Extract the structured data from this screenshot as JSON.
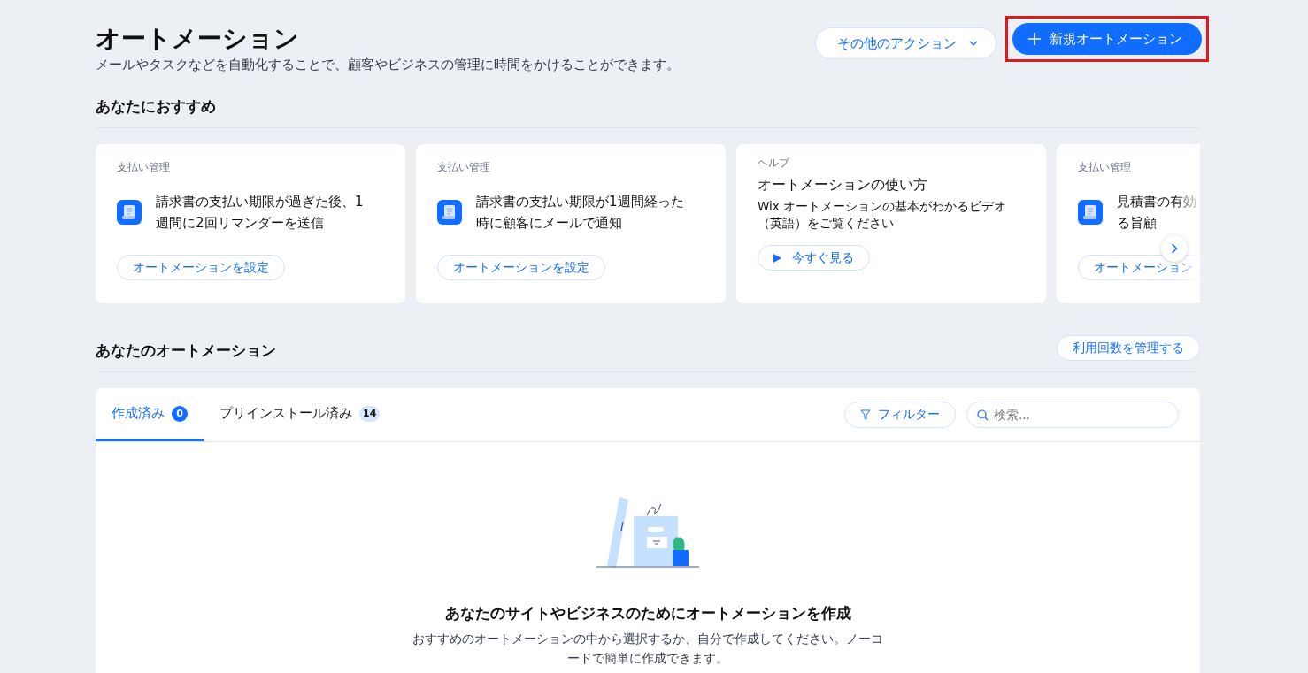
{
  "header": {
    "title": "オートメーション",
    "subtitle": "メールやタスクなどを自動化することで、顧客やビジネスの管理に時間をかけることができます。",
    "actions": [
      {
        "kind": "menu",
        "label": "その他のアクション",
        "highlighted": false
      },
      {
        "kind": "primary",
        "label": "新規オートメーション",
        "highlighted": true
      }
    ]
  },
  "recommended": {
    "heading": "あなたにおすすめ",
    "cards": [
      {
        "kind": "template",
        "category": "支払い管理",
        "title_lines": [
          "請求書の支払い期限が過ぎた後、1",
          "週間に2回リマンダーを送信"
        ],
        "button": "オートメーションを設定"
      },
      {
        "kind": "template",
        "category": "支払い管理",
        "title_lines": [
          "請求書の支払い期限が1週間経った",
          "時に顧客にメールで通知"
        ],
        "button": "オートメーションを設定"
      },
      {
        "kind": "help",
        "category": "ヘルプ",
        "title_lines": [
          "オートメーションの使い方"
        ],
        "description": "Wix オートメーションの基本がわかるビデオ（英語）をご覧ください",
        "button": "今すぐ見る"
      },
      {
        "kind": "template",
        "category": "支払い管理",
        "title_lines": [
          "見積書の有効",
          "る旨顧"
        ],
        "button": "オートメーション"
      }
    ]
  },
  "automations": {
    "heading": "あなたのオートメーション",
    "manage_button": "利用回数を管理する",
    "tabs": [
      {
        "label": "作成済み",
        "count": "0",
        "selected": true
      },
      {
        "label": "プリインストール済み",
        "count": "14",
        "selected": false
      }
    ],
    "filter_button": "フィルター",
    "search": {
      "placeholder": "検索..."
    },
    "empty_state": {
      "title": "あなたのサイトやビジネスのためにオートメーションを作成",
      "description": "おすすめのオートメーションの中から選択するか、自分で作成してください。ノーコードで簡単に作成できます。"
    }
  }
}
